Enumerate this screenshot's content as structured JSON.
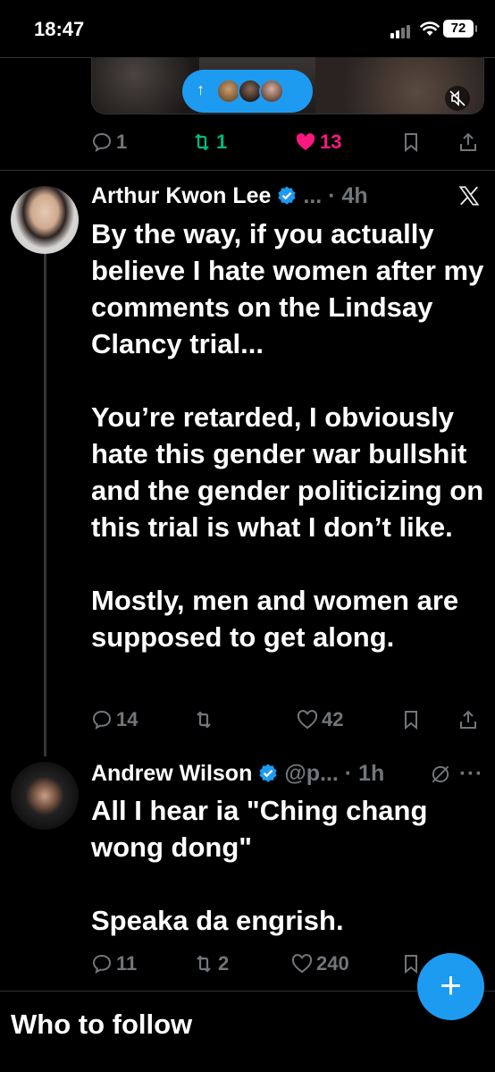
{
  "status_bar": {
    "time": "18:47",
    "battery": "72"
  },
  "media_card": {
    "new_posts_arrow": "↑"
  },
  "tweet0": {
    "actions": {
      "replies": "1",
      "retweets": "1",
      "likes": "13"
    }
  },
  "tweet1": {
    "name": "Arthur Kwon Lee",
    "meta": "... · 4h",
    "paragraphs": [
      "By the way, if you actually believe I hate women after my comments on the Lindsay Clancy trial...",
      "You’re retarded, I obviously hate this gender war bullshit and the gender politicizing on this trial is what I don’t like.",
      "Mostly, men and women are supposed to get along."
    ],
    "actions": {
      "replies": "14",
      "retweets": "",
      "likes": "42"
    }
  },
  "tweet2": {
    "name": "Andrew Wilson",
    "meta": "@p... · 1h",
    "more": "···",
    "paragraphs": [
      "All I hear ia \"Ching chang wong dong\"",
      "Speaka da engrish."
    ],
    "actions": {
      "replies": "11",
      "retweets": "2",
      "likes": "240"
    }
  },
  "who_to_follow": "Who to follow",
  "fab": {
    "label": "+"
  },
  "colors": {
    "background": "#000000",
    "accent": "#1d9bf0",
    "retweet": "#00ba7c",
    "like": "#f91880",
    "muted": "#71767b",
    "divider": "#2f3336"
  },
  "icons": [
    "signal-icon",
    "wifi-icon",
    "battery-icon",
    "reply-icon",
    "retweet-icon",
    "like-icon",
    "bookmark-icon",
    "share-icon",
    "verified-icon",
    "x-logo-icon",
    "grok-icon",
    "more-icon",
    "mute-icon",
    "compose-icon"
  ]
}
